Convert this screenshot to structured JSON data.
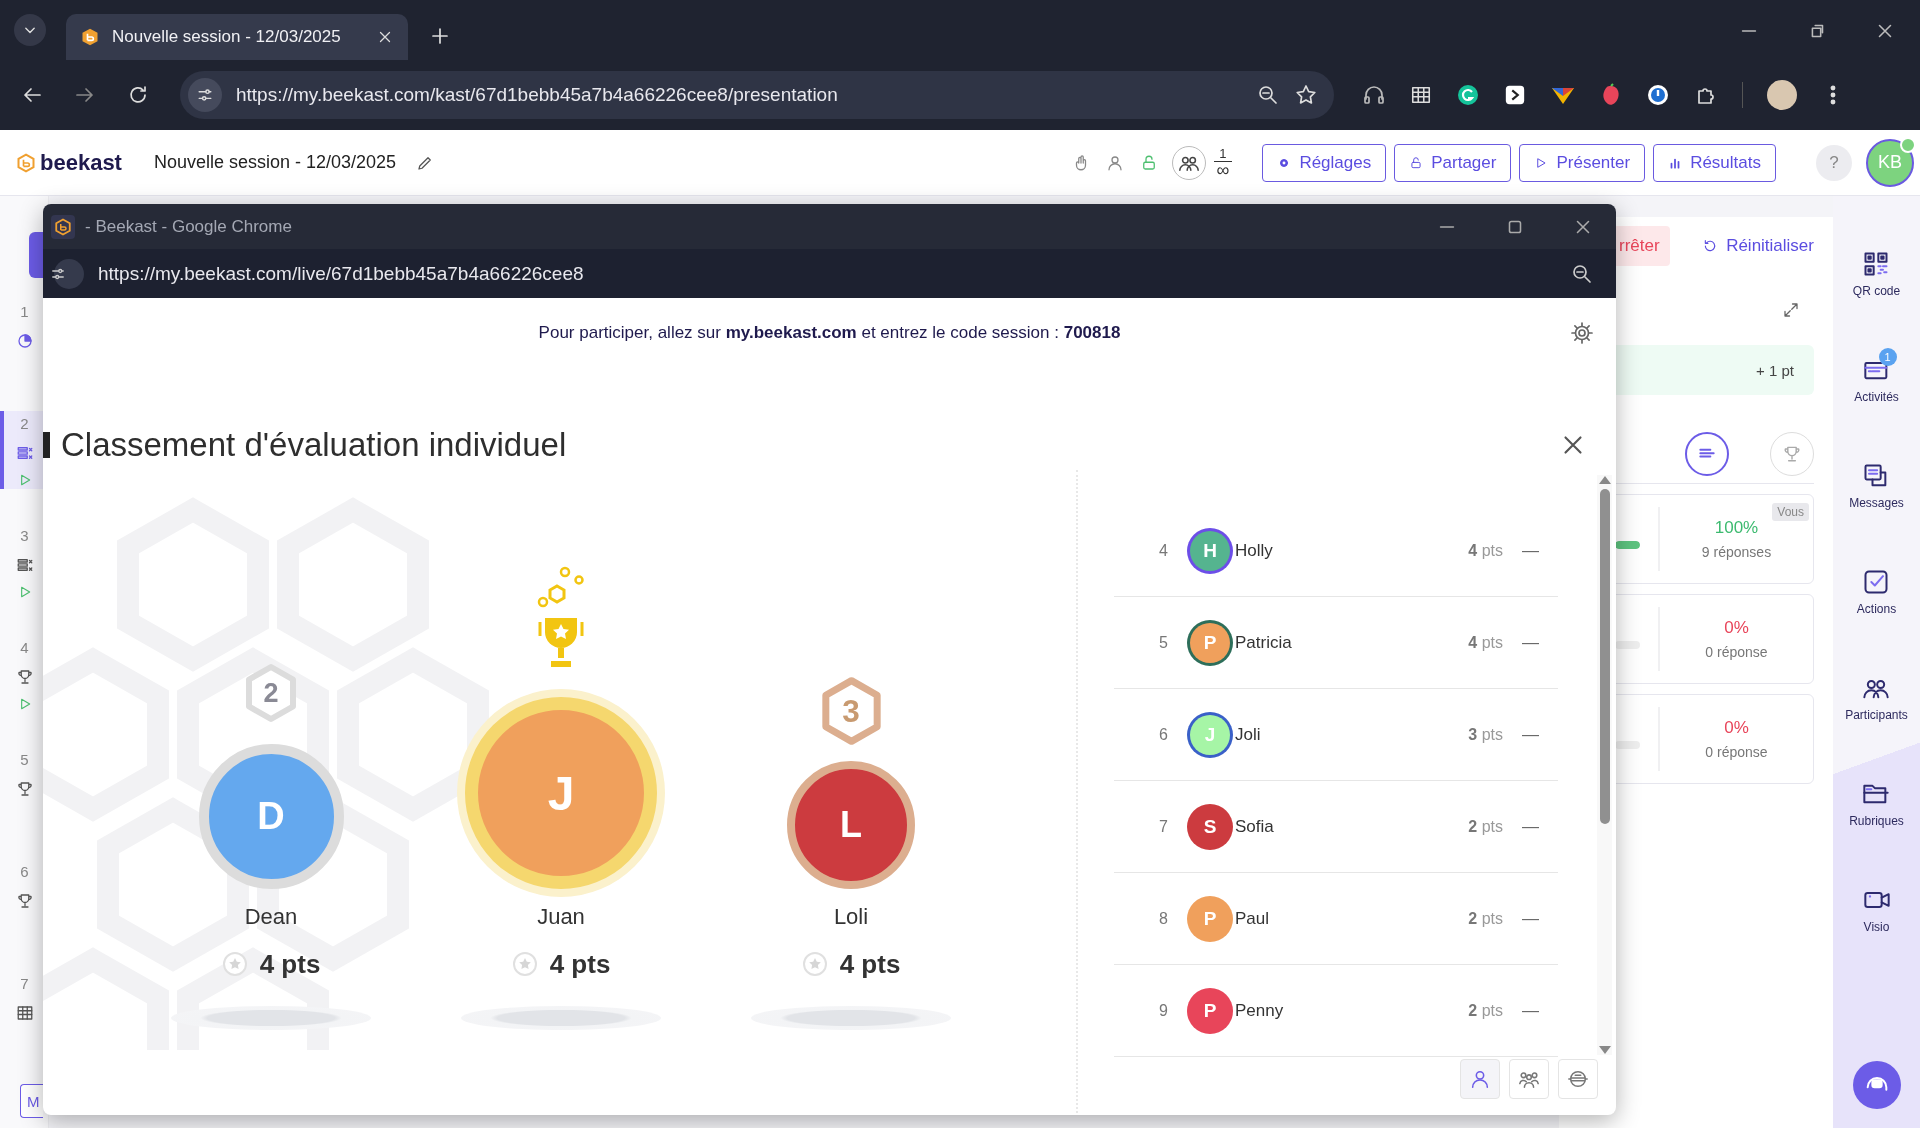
{
  "browser": {
    "tabs": [
      {
        "title": "Nouvelle session - 12/03/2025",
        "selected": true
      }
    ],
    "url": "https://my.beekast.com/kast/67d1bebb45a7b4a66226cee8/presentation"
  },
  "header": {
    "logo": "beekast",
    "session_title": "Nouvelle session - 12/03/2025",
    "participants_count": "1",
    "participants_limit": "∞",
    "buttons": [
      {
        "label": "Réglages",
        "kind": "settings"
      },
      {
        "label": "Partager",
        "kind": "share"
      },
      {
        "label": "Présenter",
        "kind": "present"
      },
      {
        "label": "Résultats",
        "kind": "results"
      }
    ],
    "help": "?",
    "user_initials": "KB"
  },
  "slides": [
    {
      "number": "1",
      "kind": "poll",
      "playable": false,
      "selected": false
    },
    {
      "number": "2",
      "kind": "quiz",
      "playable": true,
      "selected": true
    },
    {
      "number": "3",
      "kind": "quiz",
      "playable": true,
      "selected": false
    },
    {
      "number": "4",
      "kind": "ranking",
      "playable": true,
      "selected": false
    },
    {
      "number": "5",
      "kind": "ranking",
      "playable": false,
      "selected": false
    },
    {
      "number": "6",
      "kind": "ranking",
      "playable": false,
      "selected": false
    },
    {
      "number": "7",
      "kind": "table",
      "playable": false,
      "selected": false
    }
  ],
  "slides_footer_button": "M",
  "results_panel": {
    "stop_button": "rrêter",
    "reset_button": "Réinitialiser",
    "points": "+ 1 pt",
    "views": [
      {
        "kind": "list",
        "selected": true
      },
      {
        "kind": "ranking",
        "selected": false
      }
    ],
    "answers": [
      {
        "badge": "Vous",
        "percent": "100%",
        "responses": "9 réponses",
        "level": 1
      },
      {
        "percent": "0%",
        "responses": "0 réponse",
        "level": 0
      },
      {
        "percent": "0%",
        "responses": "0 réponse",
        "level": 0
      }
    ]
  },
  "tool_rail": [
    {
      "label": "QR code",
      "kind": "qr"
    },
    {
      "label": "Activités",
      "kind": "activities",
      "badge": "1"
    },
    {
      "label": "Messages",
      "kind": "messages"
    },
    {
      "label": "Actions",
      "kind": "actions"
    },
    {
      "label": "Participants",
      "kind": "participants"
    },
    {
      "label": "Rubriques",
      "kind": "sections"
    },
    {
      "label": "Visio",
      "kind": "video"
    }
  ],
  "live_window": {
    "title": "- Beekast - Google Chrome",
    "url": "https://my.beekast.com/live/67d1bebb45a7b4a66226cee8",
    "instruction": "Pour participer, allez sur **my.beekast.com** et entrez le code session : **700818**",
    "heading": "Classement d'évaluation individuel",
    "podium": [
      {
        "kind": "second",
        "rank": "2",
        "initial": "D",
        "name": "Dean",
        "points": "4 pts",
        "color": "#64a8ee"
      },
      {
        "kind": "first",
        "initial": "J",
        "name": "Juan",
        "points": "4 pts",
        "color": "#f0a05c"
      },
      {
        "kind": "third",
        "rank": "3",
        "initial": "L",
        "name": "Loli",
        "points": "4 pts",
        "color": "#cc3b3f"
      }
    ],
    "ranking": [
      {
        "rank": "4",
        "initial": "H",
        "name": "Holly",
        "points": "**4** pts",
        "trend": "—",
        "color": "#55b48f",
        "ring": {
          "color": "#6c4ee8"
        }
      },
      {
        "rank": "5",
        "initial": "P",
        "name": "Patricia",
        "points": "**4** pts",
        "trend": "—",
        "color": "#f0a05c",
        "ring": {
          "color": "#2d6e5a"
        }
      },
      {
        "rank": "6",
        "initial": "J",
        "name": "Joli",
        "points": "**3** pts",
        "trend": "—",
        "color": "#a6f5a6",
        "ring": {
          "color": "#3a60c8"
        }
      },
      {
        "rank": "7",
        "initial": "S",
        "name": "Sofia",
        "points": "**2** pts",
        "trend": "—",
        "color": "#cc3b3f"
      },
      {
        "rank": "8",
        "initial": "P",
        "name": "Paul",
        "points": "**2** pts",
        "trend": "—",
        "color": "#f0a05c"
      },
      {
        "rank": "9",
        "initial": "P",
        "name": "Penny",
        "points": "**2** pts",
        "trend": "—",
        "color": "#e8455a"
      }
    ],
    "modes": [
      {
        "kind": "individual",
        "selected": true
      },
      {
        "kind": "teams",
        "selected": false
      },
      {
        "kind": "bots",
        "selected": false
      }
    ]
  }
}
